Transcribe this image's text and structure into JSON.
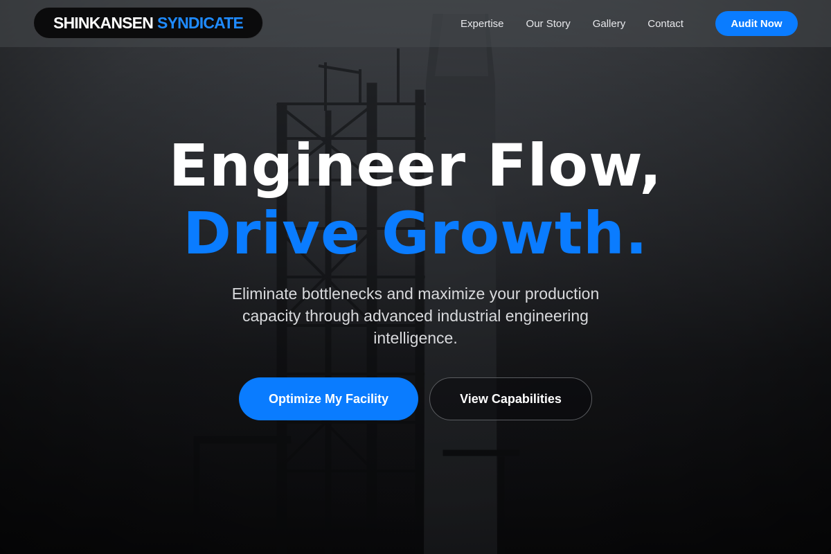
{
  "brand": {
    "name_white": "SHINKANSEN",
    "name_blue": "SYNDICATE",
    "accent_color": "#0a7cff"
  },
  "nav": {
    "links": [
      {
        "label": "Expertise"
      },
      {
        "label": "Our Story"
      },
      {
        "label": "Gallery"
      },
      {
        "label": "Contact"
      }
    ],
    "cta_label": "Audit Now"
  },
  "hero": {
    "headline_line1": "Engineer Flow,",
    "headline_line2": "Drive Growth.",
    "subtext": "Eliminate bottlenecks and maximize your production capacity through advanced industrial engineering intelligence.",
    "primary_button": "Optimize My Facility",
    "secondary_button": "View Capabilities",
    "background_image": "industrial-refinery-tower"
  }
}
